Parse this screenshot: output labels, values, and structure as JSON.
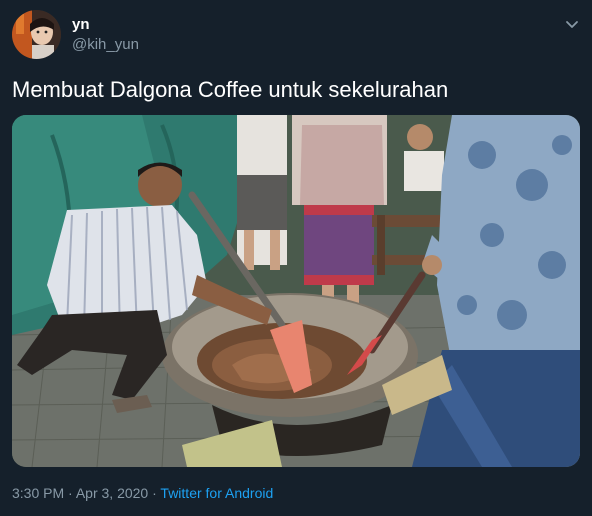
{
  "tweet": {
    "display_name": "yn",
    "handle": "@kih_yun",
    "text": "Membuat Dalgona Coffee untuk sekelurahan",
    "time": "3:30 PM",
    "separator": "·",
    "date": "Apr 3, 2020",
    "source": "Twitter for Android"
  },
  "icons": {
    "caret": "chevron-down-icon",
    "avatar": "profile-avatar-photo"
  },
  "colors": {
    "background": "#15202b",
    "text_primary": "#ffffff",
    "text_secondary": "#8899a6",
    "accent": "#1da1f2"
  },
  "media": {
    "description_alt": ""
  }
}
